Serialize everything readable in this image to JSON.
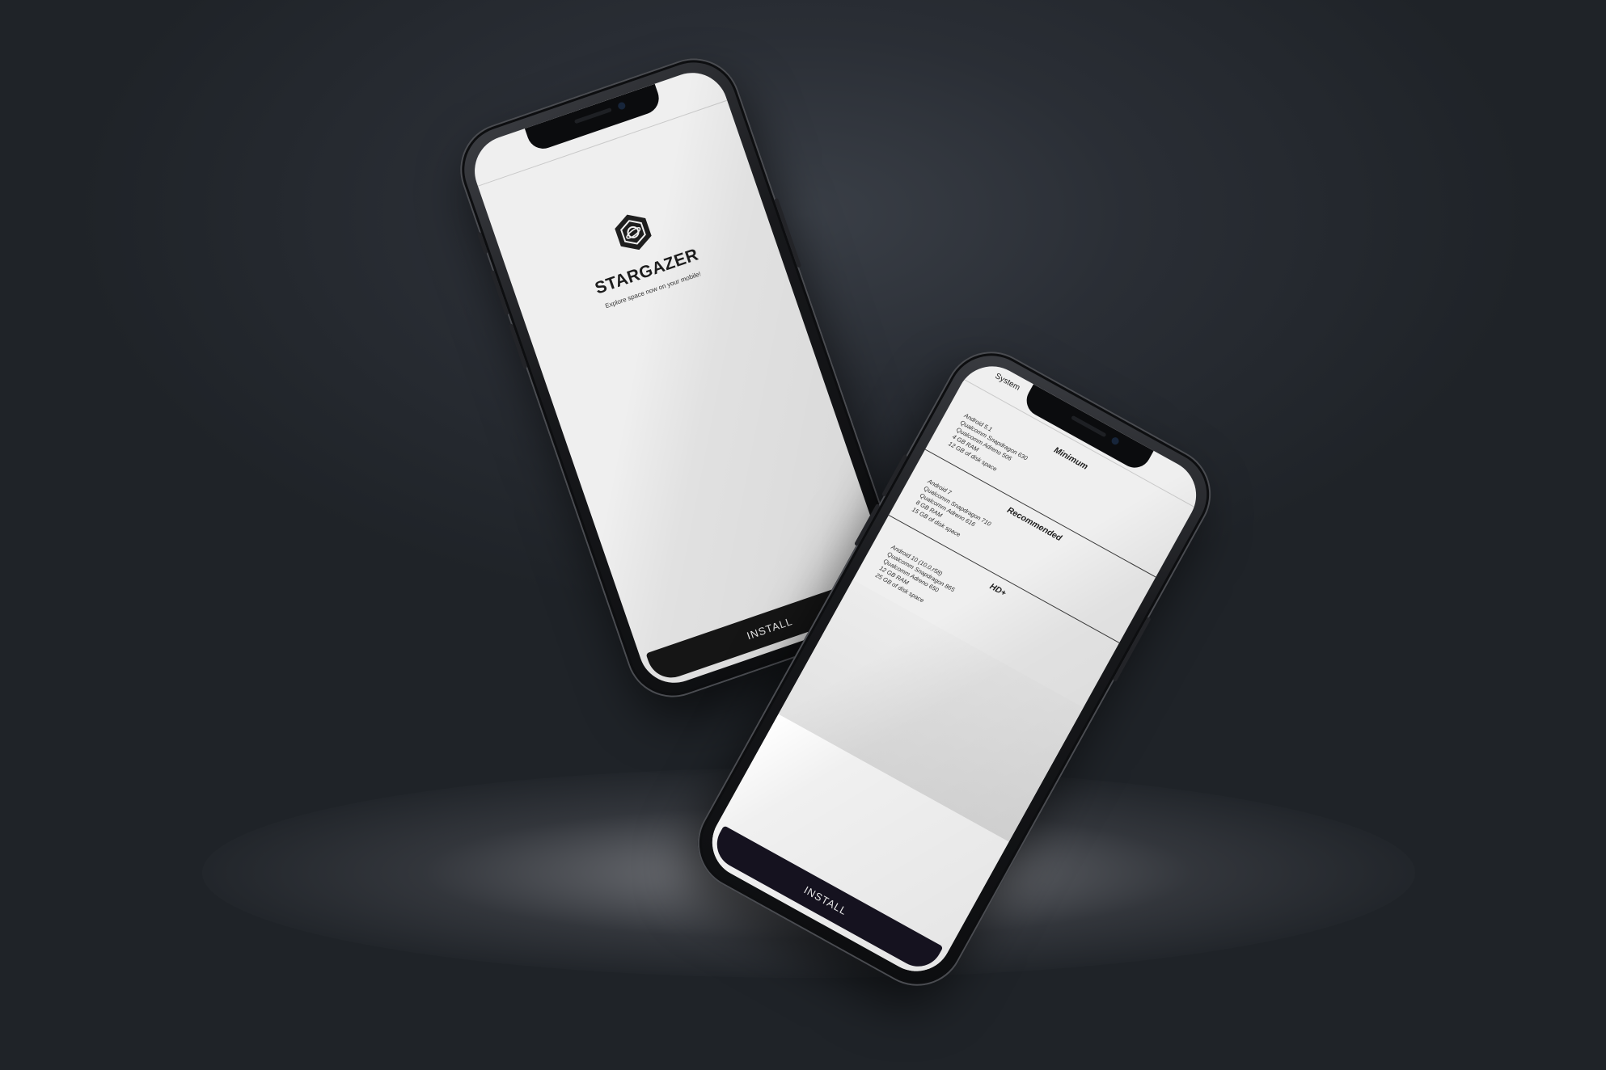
{
  "phone_a": {
    "app_name": "STARGAZER",
    "tagline": "Explore space now on your mobile!",
    "install_label": "INSTALL",
    "logo_icon": "hexagon-planet-icon"
  },
  "phone_b": {
    "tab_label": "System",
    "install_label": "INSTALL",
    "sections": [
      {
        "title": "Minimum",
        "lines": [
          "Android 5.1",
          "Qualcomm Snapdragon 630",
          "Qualcomm Adreno 506",
          "4 GB RAM",
          "12 GB of disk space"
        ]
      },
      {
        "title": "Recommended",
        "lines": [
          "Android 7",
          "Qualcomm Snapdragon 710",
          "Qualcomm Adreno 616",
          "8 GB RAM",
          "15 GB of disk space"
        ]
      },
      {
        "title": "HD+",
        "lines": [
          "Android 10 (10.0.r58)",
          "Qualcomm Snapdragon 865",
          "Qualcomm Adreno 650",
          "12 GB RAM",
          "25 GB of disk space"
        ]
      }
    ]
  }
}
